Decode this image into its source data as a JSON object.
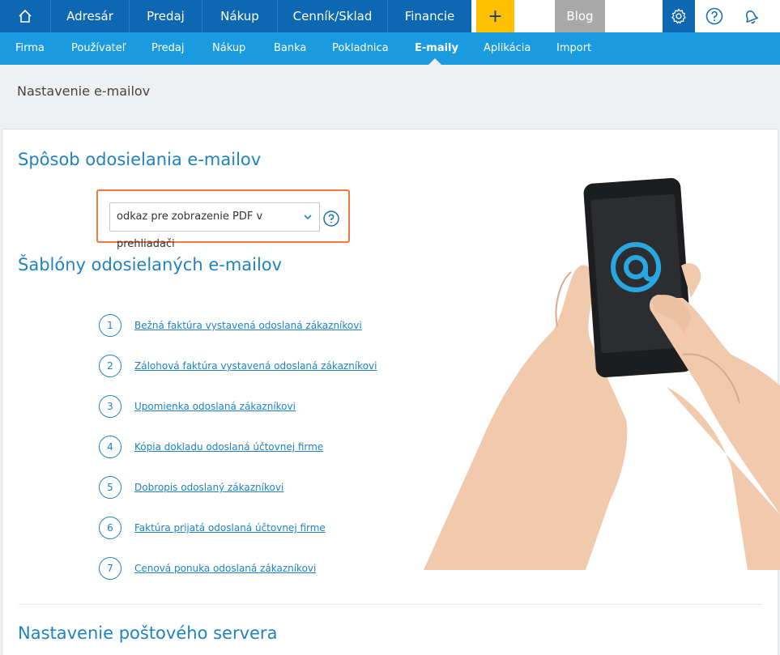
{
  "topnav": {
    "items": [
      "Adresár",
      "Predaj",
      "Nákup",
      "Cenník/Sklad",
      "Financie"
    ],
    "plus_label": "+",
    "blog_label": "Blog"
  },
  "subnav": {
    "items": [
      "Firma",
      "Používateľ",
      "Predaj",
      "Nákup",
      "Banka",
      "Pokladnica",
      "E-maily",
      "Aplikácia",
      "Import"
    ],
    "active": "E-maily"
  },
  "page": {
    "title": "Nastavenie e-mailov"
  },
  "sending": {
    "heading": "Spôsob odosielania e-mailov",
    "select_value": "odkaz pre zobrazenie PDF v prehliadači"
  },
  "templates": {
    "heading": "Šablóny odosielaných e-mailov",
    "items": [
      {
        "num": "1",
        "label": "Bežná faktúra vystavená odoslaná zákazníkovi"
      },
      {
        "num": "2",
        "label": "Zálohová faktúra vystavená odoslaná zákazníkovi"
      },
      {
        "num": "3",
        "label": "Upomienka odoslaná zákazníkovi"
      },
      {
        "num": "4",
        "label": "Kópia dokladu odoslaná účtovnej firme"
      },
      {
        "num": "5",
        "label": "Dobropis odoslaný zákazníkovi"
      },
      {
        "num": "6",
        "label": "Faktúra prijatá odoslaná účtovnej firme"
      },
      {
        "num": "7",
        "label": "Cenová ponuka odoslaná zákazníkovi"
      }
    ]
  },
  "server": {
    "heading": "Nastavenie poštového servera"
  },
  "icons": {
    "home": "home-icon",
    "settings": "gear-icon",
    "help": "question-icon",
    "notifications": "bell-icon",
    "select_chevron": "chevron-down-icon"
  },
  "colors": {
    "topnav": "#0d68b1",
    "subnav": "#1a9be0",
    "plus": "#ffc000",
    "blog": "#a9a9a9",
    "heading": "#1f83c2",
    "highlight": "#f07a3c"
  }
}
